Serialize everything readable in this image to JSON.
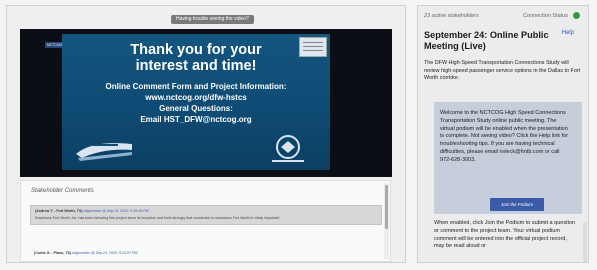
{
  "video_panel": {
    "help_banner": "Having trouble seeing the video?",
    "presenter_tag": "NCTCOG Video",
    "slide": {
      "title_line1": "Thank you for your",
      "title_line2": "interest and time!",
      "line1": "Online Comment Form and Project Information:",
      "line2": "www.nctcog.org/dfw-hstcs",
      "line3": "General Questions:",
      "line4": "Email HST_DFW@nctcog.org"
    }
  },
  "comments": {
    "title": "Stakeholder Comments",
    "items": [
      {
        "author": "(Andrew T. - Fort Worth, TX)",
        "category": "Alignments",
        "timestamp": "@ Sep 24, 2020, 5:36:49 PM",
        "body": "Downtown Fort Worth, Inc. has been following this project since its inception and feels strongly that connection to downtown Fort Worth is vitally important."
      },
      {
        "author": "(Curtis G. - Plano, TX)",
        "category": "Alignments",
        "timestamp": "@ Sep 24, 2020, 5:33:07 PM",
        "body": ""
      }
    ]
  },
  "side_panel": {
    "stakeholders": "23 active stakeholders",
    "connection_status": "Connection Status",
    "status_color": "#2e9e3e",
    "meeting_title": "September 24: Online Public Meeting (Live)",
    "help": "Help",
    "description": "The DFW High-Speed Transportation Connections Study will review high-speed passenger service options in the Dallas to Fort Worth corridor.",
    "info_box_text": "Welcome to the NCTCOG High Speed Connections Transportation Study online public meeting. The virtual podium will be enabled when the presentation is complete. Not seeing video? Click the Help link for troubleshooting tips. If you are having technical difficulties, please email nvleck@hntb.com or call 972-628-3003.",
    "join_button": "Join the Podium",
    "after_text": "When enabled, click Join the Podium to submit a question or comment to the project team. Your virtual podium comment will be entered into the official project record, may be read aloud or"
  }
}
